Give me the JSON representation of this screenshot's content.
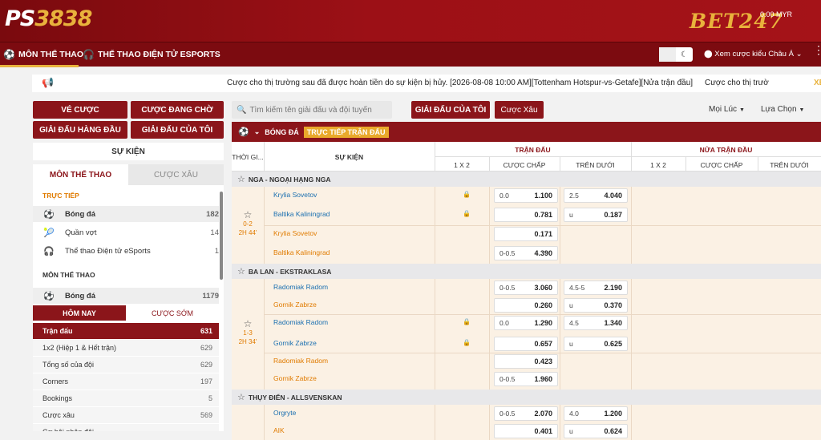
{
  "brand": {
    "logo_part1": "PS",
    "logo_part2": "3838",
    "logo2": "BET247",
    "balance": "0.00 MYR"
  },
  "nav": {
    "sports": "MÔN THỂ THAO",
    "esports": "THỂ THAO ĐIỆN TỬ ESPORTS",
    "odds_view": "Xem cược kiểu Châu Á"
  },
  "ticker": {
    "text": "Cược cho thị trường sau đã được hoàn tiền do sự kiện bị hủy. [2026-08-08 10:00 AM][Tottenham Hotspur-vs-Getafe][Nửa trận đầu]",
    "text2": "Cược cho thị trườ",
    "more": "XE"
  },
  "left_buttons": {
    "my_bets": "VÉ CƯỢC",
    "pending": "CƯỢC ĐANG CHỜ",
    "top_leagues": "GIẢI ĐẤU HÀNG ĐẦU",
    "my_leagues": "GIẢI ĐẤU CỦA TÔI"
  },
  "events_label": "SỰ KIỆN",
  "sidebar_tabs": {
    "sports": "MÔN THỂ THAO",
    "parlay": "CƯỢC XÂU"
  },
  "sidebar": {
    "live_title": "TRỰC TIẾP",
    "live_items": [
      {
        "label": "Bóng đá",
        "count": "182"
      },
      {
        "label": "Quần vợt",
        "count": "14"
      },
      {
        "label": "Thể thao Điện tử eSports",
        "count": "1"
      }
    ],
    "sports_title": "MÔN THỂ THAO",
    "sports_items": [
      {
        "label": "Bóng đá",
        "count": "1179"
      }
    ],
    "day_tabs": {
      "today": "HÔM NAY",
      "early": "CƯỢC SỚM"
    },
    "markets": [
      {
        "label": "Trận đấu",
        "count": "631"
      },
      {
        "label": "1x2 (Hiệp 1 & Hết trận)",
        "count": "629"
      },
      {
        "label": "Tổng số của đội",
        "count": "629"
      },
      {
        "label": "Corners",
        "count": "197"
      },
      {
        "label": "Bookings",
        "count": "5"
      },
      {
        "label": "Cược xâu",
        "count": "569"
      },
      {
        "label": "Cơ hội nhân đôi",
        "count": "..."
      }
    ]
  },
  "search": {
    "placeholder": "Tìm kiếm tên giải đấu và đội tuyển"
  },
  "toolbar": {
    "my_leagues": "GIẢI ĐẤU CỦA TÔI",
    "parlay": "Cược Xâu",
    "time_filter": "Mọi Lúc",
    "sort": "Lựa Chọn"
  },
  "grid": {
    "sport": "BÓNG ĐÁ",
    "live_badge": "TRỰC TIẾP TRẬN ĐẤU",
    "col_time": "THỜI GI...",
    "col_event": "SỰ KIỆN",
    "full_time": "TRẬN ĐẤU",
    "first_half": "NỬA TRẬN ĐẦU",
    "sub_1x2": "1 X 2",
    "sub_hdp": "CƯỢC CHẤP",
    "sub_ou": "TRÊN DƯỚI"
  },
  "leagues": [
    {
      "name": "NGA - NGOẠI HẠNG NGA",
      "score": "0-2",
      "time": "2H 44'",
      "rows": [
        {
          "team": "Krylia Sovetov",
          "team_color": "blue",
          "hdp_h": "0.0",
          "hdp_o": "1.100",
          "ou_h": "2.5",
          "ou_o": "4.040",
          "locked": true
        },
        {
          "team": "Baltika Kaliningrad",
          "team_color": "blue",
          "hdp_h": "",
          "hdp_o": "0.781",
          "ou_h": "u",
          "ou_o": "0.187",
          "locked": true
        },
        {
          "team": "Krylia Sovetov",
          "team_color": "orange",
          "hdp_h": "",
          "hdp_o": "0.171",
          "ou_h": "",
          "ou_o": "",
          "locked": false
        },
        {
          "team": "Baltika Kaliningrad",
          "team_color": "orange",
          "hdp_h": "0-0.5",
          "hdp_o": "4.390",
          "ou_h": "",
          "ou_o": "",
          "locked": false
        }
      ]
    },
    {
      "name": "BA LAN - EKSTRAKLASA",
      "score": "1-3",
      "time": "2H 34'",
      "rows": [
        {
          "team": "Radomiak Radom",
          "team_color": "blue",
          "hdp_h": "0-0.5",
          "hdp_o": "3.060",
          "ou_h": "4.5-5",
          "ou_o": "2.190",
          "locked": false
        },
        {
          "team": "Gornik Zabrze",
          "team_color": "orange",
          "hdp_h": "",
          "hdp_o": "0.260",
          "ou_h": "u",
          "ou_o": "0.370",
          "locked": false
        },
        {
          "team": "Radomiak Radom",
          "team_color": "blue",
          "hdp_h": "0.0",
          "hdp_o": "1.290",
          "ou_h": "4.5",
          "ou_o": "1.340",
          "locked": true
        },
        {
          "team": "Gornik Zabrze",
          "team_color": "blue",
          "hdp_h": "",
          "hdp_o": "0.657",
          "ou_h": "u",
          "ou_o": "0.625",
          "locked": true
        },
        {
          "team": "Radomiak Radom",
          "team_color": "orange",
          "hdp_h": "",
          "hdp_o": "0.423",
          "ou_h": "",
          "ou_o": "",
          "locked": false
        },
        {
          "team": "Gornik Zabrze",
          "team_color": "orange",
          "hdp_h": "0-0.5",
          "hdp_o": "1.960",
          "ou_h": "",
          "ou_o": "",
          "locked": false
        }
      ]
    },
    {
      "name": "THỤY ĐIỂN - ALLSVENSKAN",
      "score": "",
      "time": "",
      "rows": [
        {
          "team": "Orgryte",
          "team_color": "blue",
          "hdp_h": "0-0.5",
          "hdp_o": "2.070",
          "ou_h": "4.0",
          "ou_o": "1.200",
          "locked": false
        },
        {
          "team": "AIK",
          "team_color": "orange",
          "hdp_h": "",
          "hdp_o": "0.401",
          "ou_h": "u",
          "ou_o": "0.624",
          "locked": false
        }
      ]
    }
  ],
  "colors": {
    "primary": "#8b151a",
    "accent": "#e9b23c",
    "match_bg": "#fbf1e4",
    "team_blue": "#1a6fb0",
    "team_orange": "#e07b00"
  }
}
